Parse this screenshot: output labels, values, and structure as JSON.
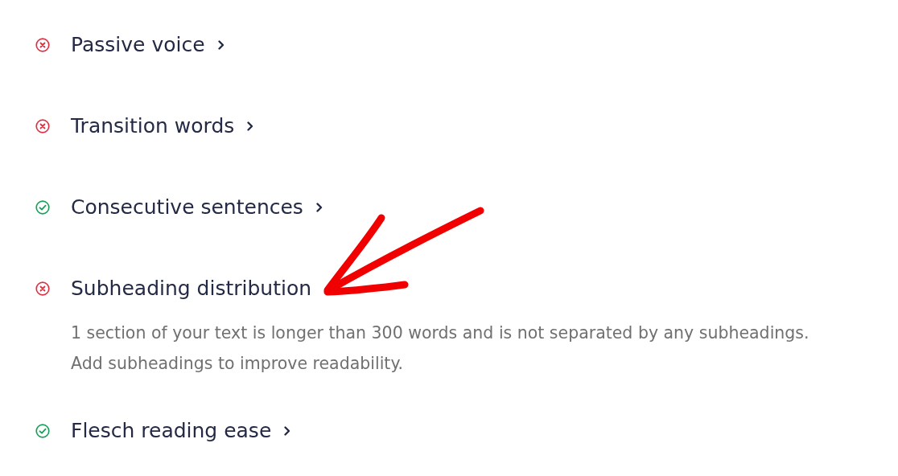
{
  "checks": [
    {
      "title": "Passive voice",
      "kind": "problem",
      "expanded": false
    },
    {
      "title": "Transition words",
      "kind": "problem",
      "expanded": false
    },
    {
      "title": "Consecutive sentences",
      "kind": "good",
      "expanded": false
    },
    {
      "title": "Subheading distribution",
      "kind": "problem",
      "expanded": true,
      "description": "1 section of your text is longer than 300 words and is not separated by any subheadings. Add subheadings to improve readability."
    },
    {
      "title": "Flesch reading ease",
      "kind": "good",
      "expanded": false
    }
  ]
}
